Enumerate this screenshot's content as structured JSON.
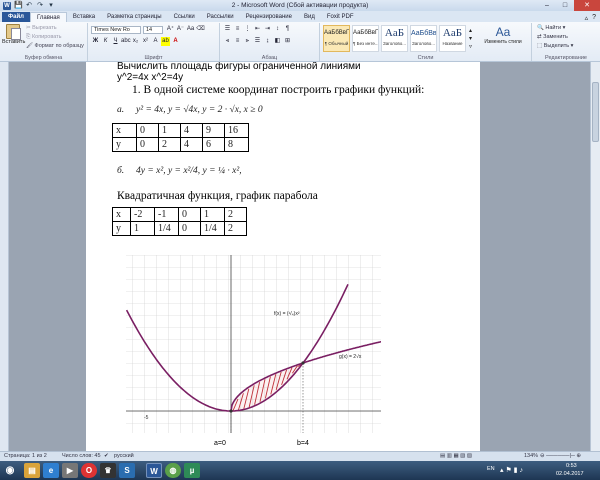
{
  "window": {
    "title": "2 - Microsoft Word (Сбой активации продукта)",
    "controls": [
      "–",
      "□",
      "✕"
    ]
  },
  "tabs": {
    "file": "Файл",
    "items": [
      "Главная",
      "Вставка",
      "Разметка страницы",
      "Ссылки",
      "Рассылки",
      "Рецензирование",
      "Вид",
      "Foxit PDF"
    ],
    "active": "Главная"
  },
  "ribbon": {
    "clipboard": {
      "paste": "Вставить",
      "cut": "Вырезать",
      "copy": "Копировать",
      "format_painter": "Формат по образцу",
      "group": "Буфер обмена"
    },
    "font": {
      "name": "Times New Ro",
      "size": "14",
      "group": "Шрифт",
      "bold": "Ж",
      "italic": "К",
      "underline": "Ч"
    },
    "paragraph": {
      "group": "Абзац"
    },
    "styles": {
      "group": "Стили",
      "items": [
        {
          "sample": "АаБбВвГг,",
          "name": "¶ Обычный"
        },
        {
          "sample": "АаБбВвГг,",
          "name": "¶ Без инте..."
        },
        {
          "sample": "AaБ",
          "name": "Заголово..."
        },
        {
          "sample": "АаБбВв",
          "name": "Заголово..."
        },
        {
          "sample": "AaБ",
          "name": "Название"
        }
      ],
      "change": "Изменить стили"
    },
    "editing": {
      "group": "Редактирование",
      "find": "Найти",
      "replace": "Заменить",
      "select": "Выделить"
    }
  },
  "document": {
    "line1": "Вычислить площадь фигуры ограниченной линиями",
    "line2": "y^2=4x x^2=4y",
    "item1": "1.   В одной системе координат построить графики функций:",
    "eq_a_label": "а.",
    "eq_a": "y² = 4x,    y = √4x,    y = 2 · √x,    x ≥ 0",
    "table1": [
      [
        "x",
        "0",
        "1",
        "4",
        "9",
        "16"
      ],
      [
        "y",
        "0",
        "2",
        "4",
        "6",
        "8"
      ]
    ],
    "eq_b_label": "б.",
    "eq_b": "4y = x²,    y = x²/4,    y = ¼ · x²,",
    "quadratic": "Квадратичная функция, график парабола",
    "table2": [
      [
        "x",
        "-2",
        "-1",
        "0",
        "1",
        "2"
      ],
      [
        "y",
        "1",
        "1/4",
        "0",
        "1/4",
        "2"
      ]
    ],
    "graph": {
      "f_label": "f(x) = (¹/₄)x²",
      "g_label": "g(x) = 2√x",
      "a_label": "a=0",
      "b_label": "b=4",
      "tick_label": "-5"
    }
  },
  "status": {
    "page": "Страница: 1 из 2",
    "words": "Число слов: 45",
    "language": "русский",
    "zoom": "134%"
  },
  "taskbar": {
    "lang": "EN",
    "time": "0:53",
    "date": "02.04.2017"
  }
}
